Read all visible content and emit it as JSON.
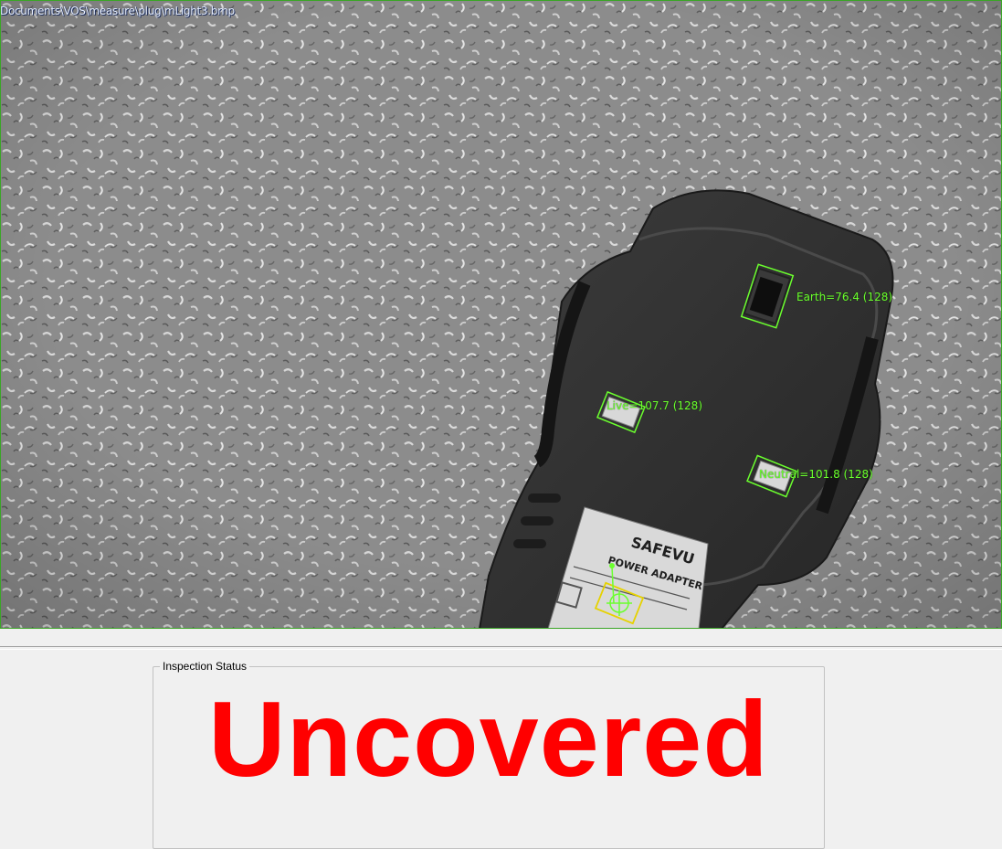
{
  "viewer": {
    "file_path": "Documents\\VOS\\measure\\plug\\mLight3.bmp",
    "overlay_color": "#6bff2e",
    "rois": [
      {
        "name": "Earth",
        "value": "76.4",
        "threshold": "128",
        "label": "Earth=76.4 (128)"
      },
      {
        "name": "Live",
        "value": "107.7",
        "threshold": "128",
        "label": "Live=107.7 (128)"
      },
      {
        "name": "Neutral",
        "value": "101.8",
        "threshold": "128",
        "label": "Neutral=101.8 (128)"
      }
    ],
    "product_labels": {
      "brand": "SAFEVU",
      "product": "POWER ADAPTER"
    }
  },
  "inspection": {
    "group_title": "Inspection Status",
    "status": "Uncovered",
    "status_color": "#ff0000"
  }
}
